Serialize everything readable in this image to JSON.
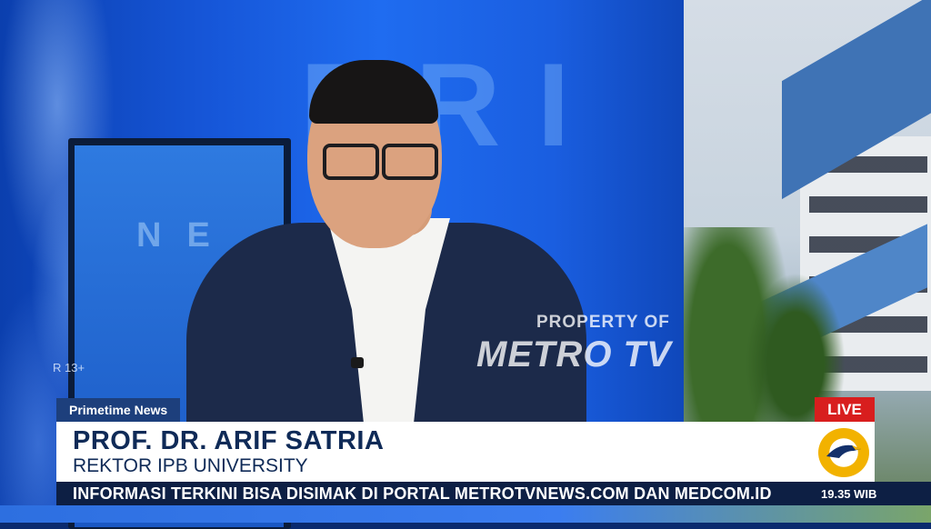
{
  "background": {
    "wall_letters": "PRI",
    "monitor_letters": "NE",
    "age_rating": "R 13+"
  },
  "watermark": {
    "line1": "PROPERTY OF",
    "logo_text": "METRO TV"
  },
  "lower_third": {
    "program": "Primetime News",
    "live": "LIVE",
    "guest_name": "PROF. DR. ARIF SATRIA",
    "guest_title": "REKTOR IPB UNIVERSITY",
    "ticker": "INFORMASI TERKINI BISA DISIMAK DI PORTAL METROTVNEWS.COM DAN MEDCOM.ID",
    "clock": "19.35 WIB"
  },
  "colors": {
    "live_red": "#d81e1e",
    "navy": "#0f2a57",
    "studio_blue": "#1656d8",
    "logo_gold": "#f2b200"
  },
  "icons": [
    "metrotv-eagle-icon"
  ]
}
